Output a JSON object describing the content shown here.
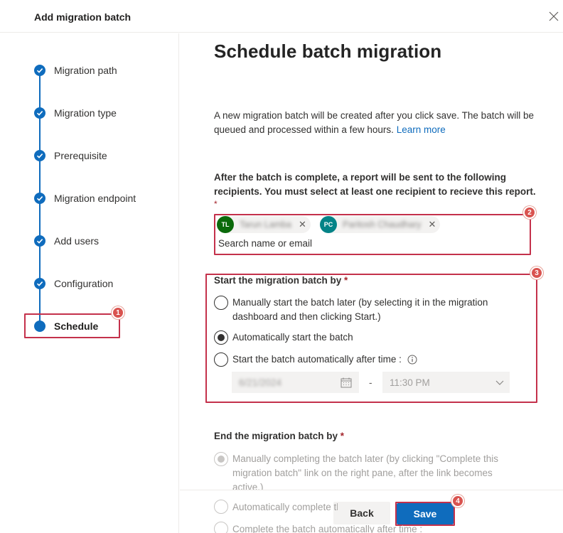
{
  "dialog": {
    "title": "Add migration batch"
  },
  "steps": [
    {
      "label": "Migration path",
      "state": "completed"
    },
    {
      "label": "Migration type",
      "state": "completed"
    },
    {
      "label": "Prerequisite",
      "state": "completed"
    },
    {
      "label": "Migration endpoint",
      "state": "completed"
    },
    {
      "label": "Add users",
      "state": "completed"
    },
    {
      "label": "Configuration",
      "state": "completed"
    },
    {
      "label": "Schedule",
      "state": "current"
    }
  ],
  "page": {
    "title": "Schedule batch migration",
    "intro": "A new migration batch will be created after you click save. The batch will be queued and processed within a few hours.",
    "learn_more": "Learn more"
  },
  "report": {
    "label": "After the batch is complete, a report will be sent to the following recipients. You must select at least one recipient to recieve this report.",
    "required_mark": "*",
    "recipients": [
      {
        "initials": "TL",
        "name": "Tarun Lamba",
        "avatar_color": "#0b6a0b"
      },
      {
        "initials": "PC",
        "name": "Paritosh Chaudhary",
        "avatar_color": "#038387"
      }
    ],
    "search_placeholder": "Search name or email"
  },
  "start": {
    "label": "Start the migration batch by",
    "required_mark": "*",
    "options": [
      {
        "label": "Manually start the batch later (by selecting it in the migration dashboard and then clicking Start.)",
        "checked": false
      },
      {
        "label": "Automatically start the batch",
        "checked": true
      },
      {
        "label": "Start the batch automatically after time :",
        "checked": false
      }
    ],
    "date_value": "6/21/2024",
    "separator": "-",
    "time_value": "11:30 PM"
  },
  "end": {
    "label": "End the migration batch by",
    "required_mark": "*",
    "options": [
      {
        "label": "Manually completing the batch later (by clicking \"Complete this migration batch\" link on the right pane, after the link becomes active.)",
        "checked": true
      },
      {
        "label": "Automatically complete the migration batch",
        "checked": false
      },
      {
        "label": "Complete the batch automatically after time :",
        "checked": false
      }
    ]
  },
  "footer": {
    "back_label": "Back",
    "save_label": "Save"
  },
  "callouts": [
    "1",
    "2",
    "3",
    "4"
  ],
  "colors": {
    "accent": "#0f6cbd",
    "callout": "#c4314b",
    "badge": "#d9534f"
  }
}
